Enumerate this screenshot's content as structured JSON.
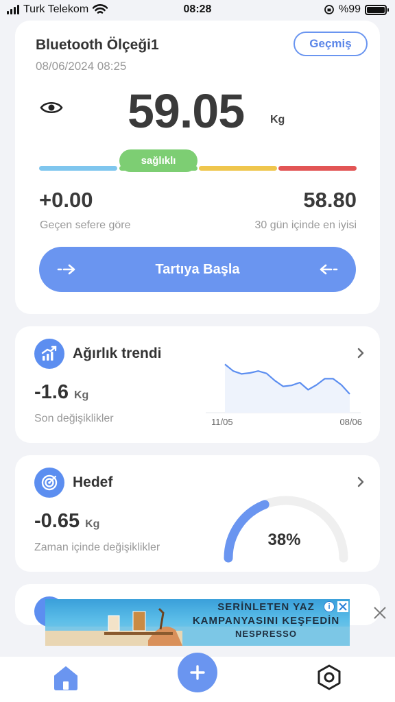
{
  "status_bar": {
    "carrier": "Turk Telekom",
    "time": "08:28",
    "battery": "%99",
    "battery_level": 0.99
  },
  "main_card": {
    "device_name": "Bluetooth Ölçeği1",
    "date": "08/06/2024 08:25",
    "history_label": "Geçmiş",
    "weight": "59.05",
    "unit": "Kg",
    "health_status": "sağlıklı",
    "change_value": "+0.00",
    "change_caption": "Geçen sefere göre",
    "best_value": "58.80",
    "best_caption": "30 gün içinde en iyisi",
    "start_label": "Tartıya Başla"
  },
  "trend_card": {
    "title": "Ağırlık trendi",
    "value": "-1.6",
    "unit": "Kg",
    "caption": "Son değişiklikler",
    "chart_data": {
      "type": "area",
      "x_start_label": "11/05",
      "x_end_label": "08/06",
      "points": [
        0.98,
        0.84,
        0.78,
        0.8,
        0.84,
        0.79,
        0.64,
        0.52,
        0.54,
        0.6,
        0.45,
        0.55,
        0.68,
        0.68,
        0.55,
        0.36
      ],
      "color": "#5c8ef0"
    }
  },
  "goal_card": {
    "title": "Hedef",
    "value": "-0.65",
    "unit": "Kg",
    "caption": "Zaman içinde değişiklikler",
    "percent_text": "38%",
    "progress": 0.38
  },
  "ad": {
    "line1": "SERİNLETEN YAZ",
    "line2": "KAMPANYASINI KEŞFEDİN",
    "brand": "NESPRESSO",
    "info_label": "i"
  },
  "colors": {
    "accent": "#6a95f0",
    "healthy": "#7dce73",
    "underweight": "#7fc6ee",
    "overweight": "#efc64d",
    "obese": "#e25555"
  }
}
